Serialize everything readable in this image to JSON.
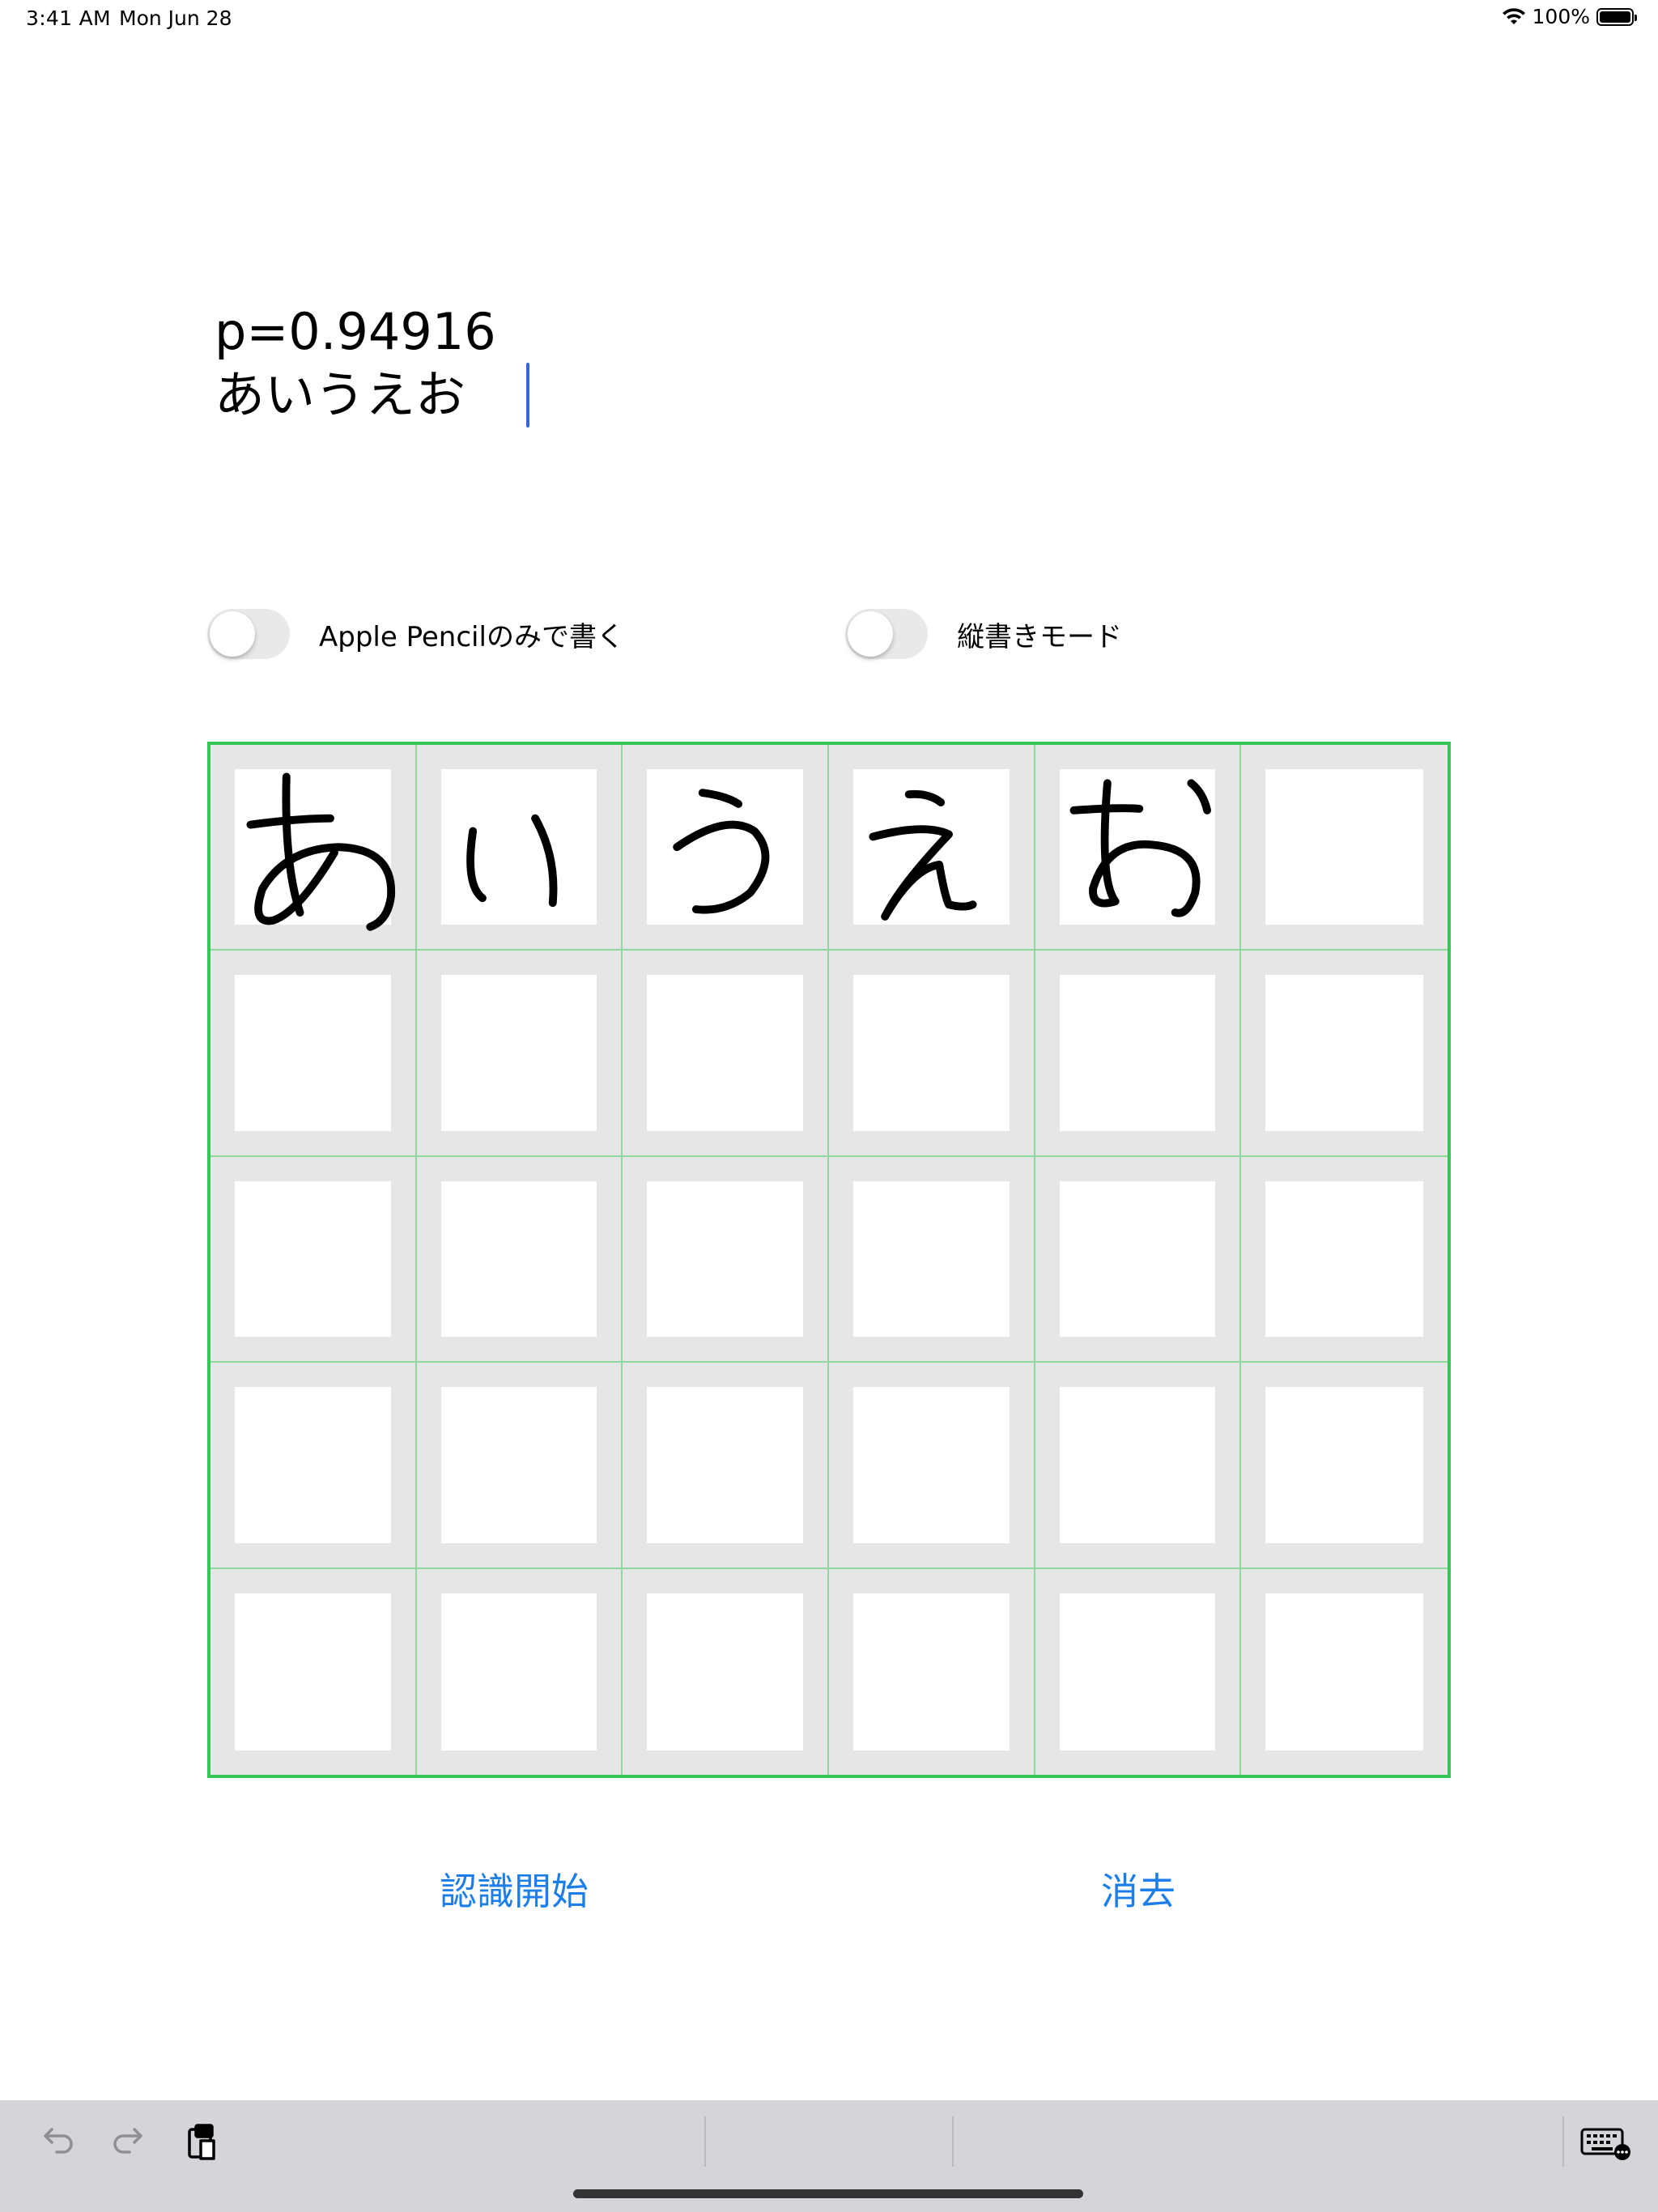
{
  "status": {
    "time": "3:41 AM",
    "date": "Mon Jun 28",
    "battery": "100%"
  },
  "result": {
    "probability": "p=0.94916",
    "text": "あいうえお"
  },
  "toggles": {
    "pencil_only": {
      "label": "Apple Pencilのみで書く",
      "on": false
    },
    "vertical_mode": {
      "label": "縦書きモード",
      "on": false
    }
  },
  "grid": {
    "columns": 6,
    "rows": 5,
    "handwritten": [
      "あ",
      "い",
      "う",
      "え",
      "お"
    ]
  },
  "buttons": {
    "recognize": "認識開始",
    "erase": "消去"
  },
  "icons": [
    "undo-icon",
    "redo-icon",
    "paste-icon",
    "keyboard-icon"
  ],
  "colors": {
    "accent": "#1c7ee8",
    "grid_border": "#34c759",
    "caret": "#3867d6"
  }
}
